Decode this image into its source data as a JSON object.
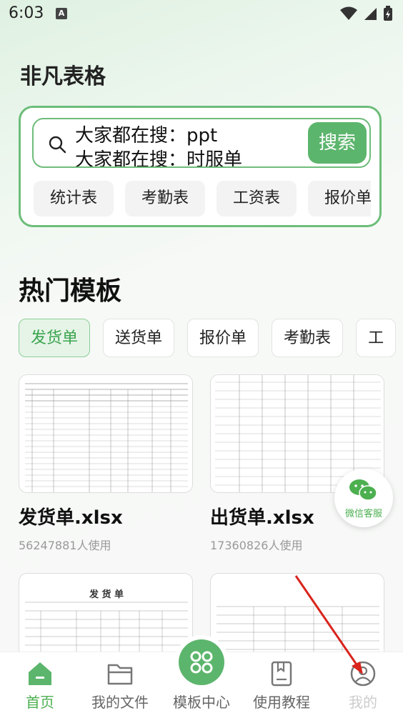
{
  "status": {
    "time": "6:03",
    "badge": "A"
  },
  "app_title": "非凡表格",
  "search": {
    "hint_line1": "大家都在搜：ppt",
    "hint_line2": "大家都在搜：时服单",
    "button_label": "搜索"
  },
  "quick_tags": [
    "统计表",
    "考勤表",
    "工资表",
    "报价单"
  ],
  "section_title": "热门模板",
  "category_tabs": [
    "发货单",
    "送货单",
    "报价单",
    "考勤表",
    "工"
  ],
  "templates": [
    {
      "title": "发货单.xlsx",
      "usage": "56247881人使用"
    },
    {
      "title": "出货单.xlsx",
      "usage": "17360826人使用"
    }
  ],
  "lower_thumbs": {
    "left_heading": "发 货 单"
  },
  "wechat": {
    "label": "微信客服"
  },
  "nav": {
    "items": [
      "首页",
      "我的文件",
      "模板中心",
      "使用教程",
      "我的"
    ]
  },
  "colors": {
    "accent": "#5cb56c",
    "accent_text": "#4caf50",
    "arrow": "#d9241c"
  }
}
